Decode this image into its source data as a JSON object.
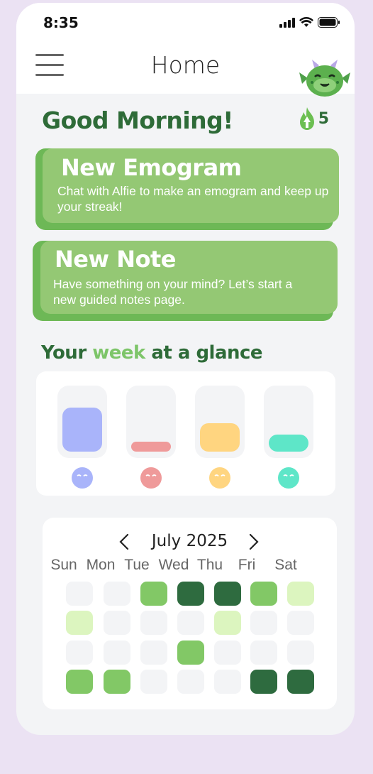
{
  "status": {
    "time": "8:35"
  },
  "header": {
    "title": "Home"
  },
  "greeting": "Good Morning!",
  "streak": {
    "count": "5"
  },
  "cards": [
    {
      "title": "New Emogram",
      "description": "Chat with Alfie to make an emogram and keep up your streak!"
    },
    {
      "title": "New Note",
      "description": "Have something on your mind? Let’s start a new guided notes page."
    }
  ],
  "week": {
    "title_prefix": "Your ",
    "title_accent": "week",
    "title_suffix": " at a glance",
    "moods": [
      {
        "level": 0.74,
        "color": "#a9b4fa",
        "face": "#a9b4fa"
      },
      {
        "level": 0.17,
        "color": "#ef9a9a",
        "face": "#ef9a9a"
      },
      {
        "level": 0.48,
        "color": "#ffd580",
        "face": "#ffd580"
      },
      {
        "level": 0.28,
        "color": "#5ee6c8",
        "face": "#5ee6c8"
      }
    ]
  },
  "calendar": {
    "month": "July 2025",
    "prev_icon": "chevron-left-icon",
    "next_icon": "chevron-right-icon",
    "weekdays": [
      "Sun",
      "Mon",
      "Tue",
      "Wed",
      "Thu",
      "Fri",
      "Sat"
    ],
    "colors": {
      "0": "#f3f4f6",
      "1": "#dcf5bf",
      "2": "#82c866",
      "3": "#2e6b3f"
    },
    "grid": [
      [
        0,
        0,
        2,
        3,
        3,
        2,
        1
      ],
      [
        1,
        0,
        0,
        0,
        1,
        0,
        0
      ],
      [
        0,
        0,
        0,
        2,
        0,
        0,
        0
      ],
      [
        2,
        2,
        0,
        0,
        0,
        3,
        3
      ]
    ]
  },
  "colors": {
    "primary_dark": "#2e6b38",
    "card": "#94c874",
    "card_shadow": "#6db856",
    "accent": "#7dc569"
  }
}
